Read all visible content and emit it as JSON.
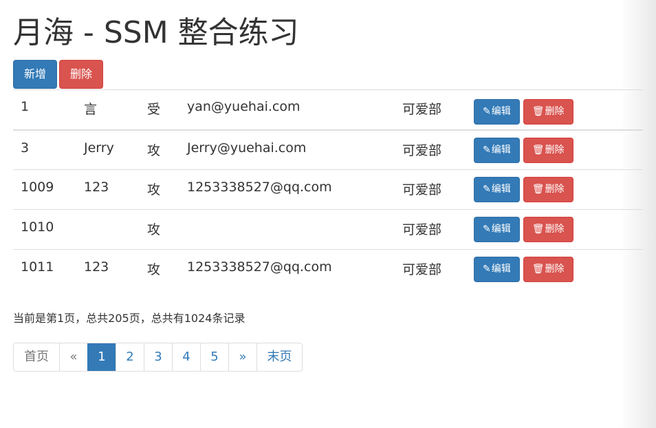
{
  "page": {
    "title": "月海 - SSM 整合练习"
  },
  "toolbar": {
    "add_label": "新增",
    "delete_label": "删除"
  },
  "table": {
    "edit_label": "编辑",
    "delete_label": "删除",
    "rows": [
      {
        "id": "1",
        "name": "言",
        "gender": "受",
        "email": "yan@yuehai.com",
        "dept": "可爱部"
      },
      {
        "id": "3",
        "name": "Jerry",
        "gender": "攻",
        "email": "Jerry@yuehai.com",
        "dept": "可爱部"
      },
      {
        "id": "1009",
        "name": "123",
        "gender": "攻",
        "email": "1253338527@qq.com",
        "dept": "可爱部"
      },
      {
        "id": "1010",
        "name": "",
        "gender": "攻",
        "email": "",
        "dept": "可爱部"
      },
      {
        "id": "1011",
        "name": "123",
        "gender": "攻",
        "email": "1253338527@qq.com",
        "dept": "可爱部"
      }
    ]
  },
  "page_info": "当前是第1页，总共205页，总共有1024条记录",
  "pagination": {
    "first": "首页",
    "prev": "«",
    "pages": [
      "1",
      "2",
      "3",
      "4",
      "5"
    ],
    "current": 1,
    "next": "»",
    "last": "末页"
  },
  "colors": {
    "primary": "#337ab7",
    "danger": "#d9534f"
  },
  "icons": {
    "edit": "pencil-icon",
    "delete": "trash-icon"
  }
}
